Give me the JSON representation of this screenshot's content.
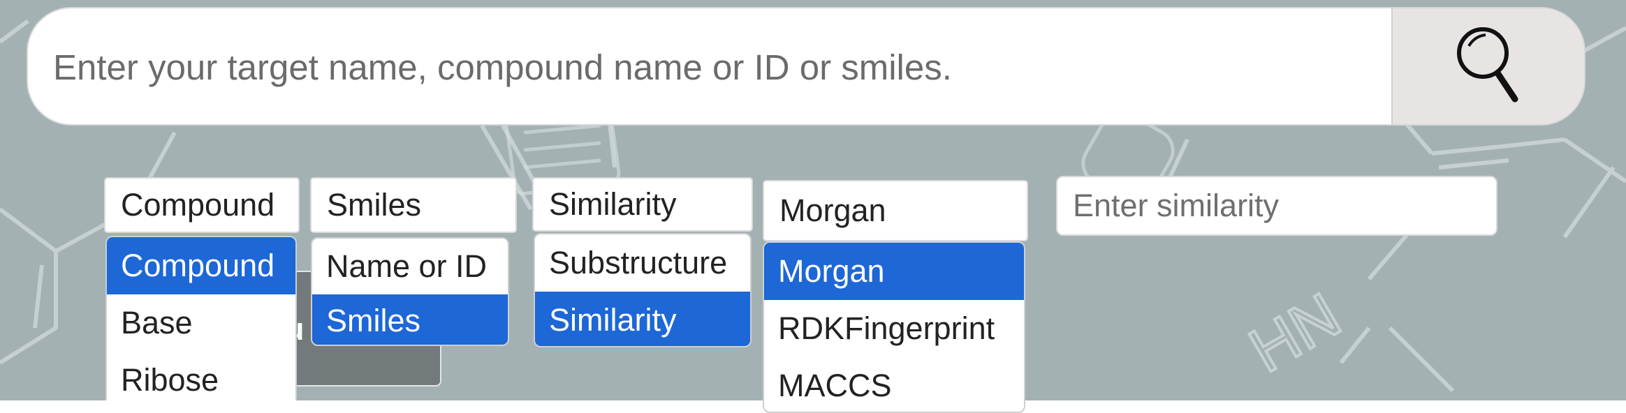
{
  "search": {
    "placeholder": "Enter your target name, compound name or ID or smiles.",
    "button_icon": "search-icon"
  },
  "selects": {
    "type": {
      "value": "Compound",
      "options": [
        "Compound",
        "Base",
        "Ribose"
      ],
      "selected_index": 0
    },
    "input_format": {
      "value": "Smiles",
      "options": [
        "Name or ID",
        "Smiles"
      ],
      "selected_index": 1
    },
    "search_mode": {
      "value": "Similarity",
      "options": [
        "Substructure",
        "Similarity"
      ],
      "selected_index": 1
    },
    "fingerprint": {
      "value": "Morgan",
      "options": [
        "Morgan",
        "RDKFingerprint",
        "MACCS"
      ],
      "selected_index": 0
    }
  },
  "similarity_input": {
    "placeholder": "Enter similarity"
  },
  "partial_button": {
    "visible_text": "u"
  },
  "colors": {
    "background": "#a3b1b3",
    "selected_option": "#1d67d6",
    "search_button": "#e7e4e3",
    "hidden_button": "#737a7b"
  }
}
